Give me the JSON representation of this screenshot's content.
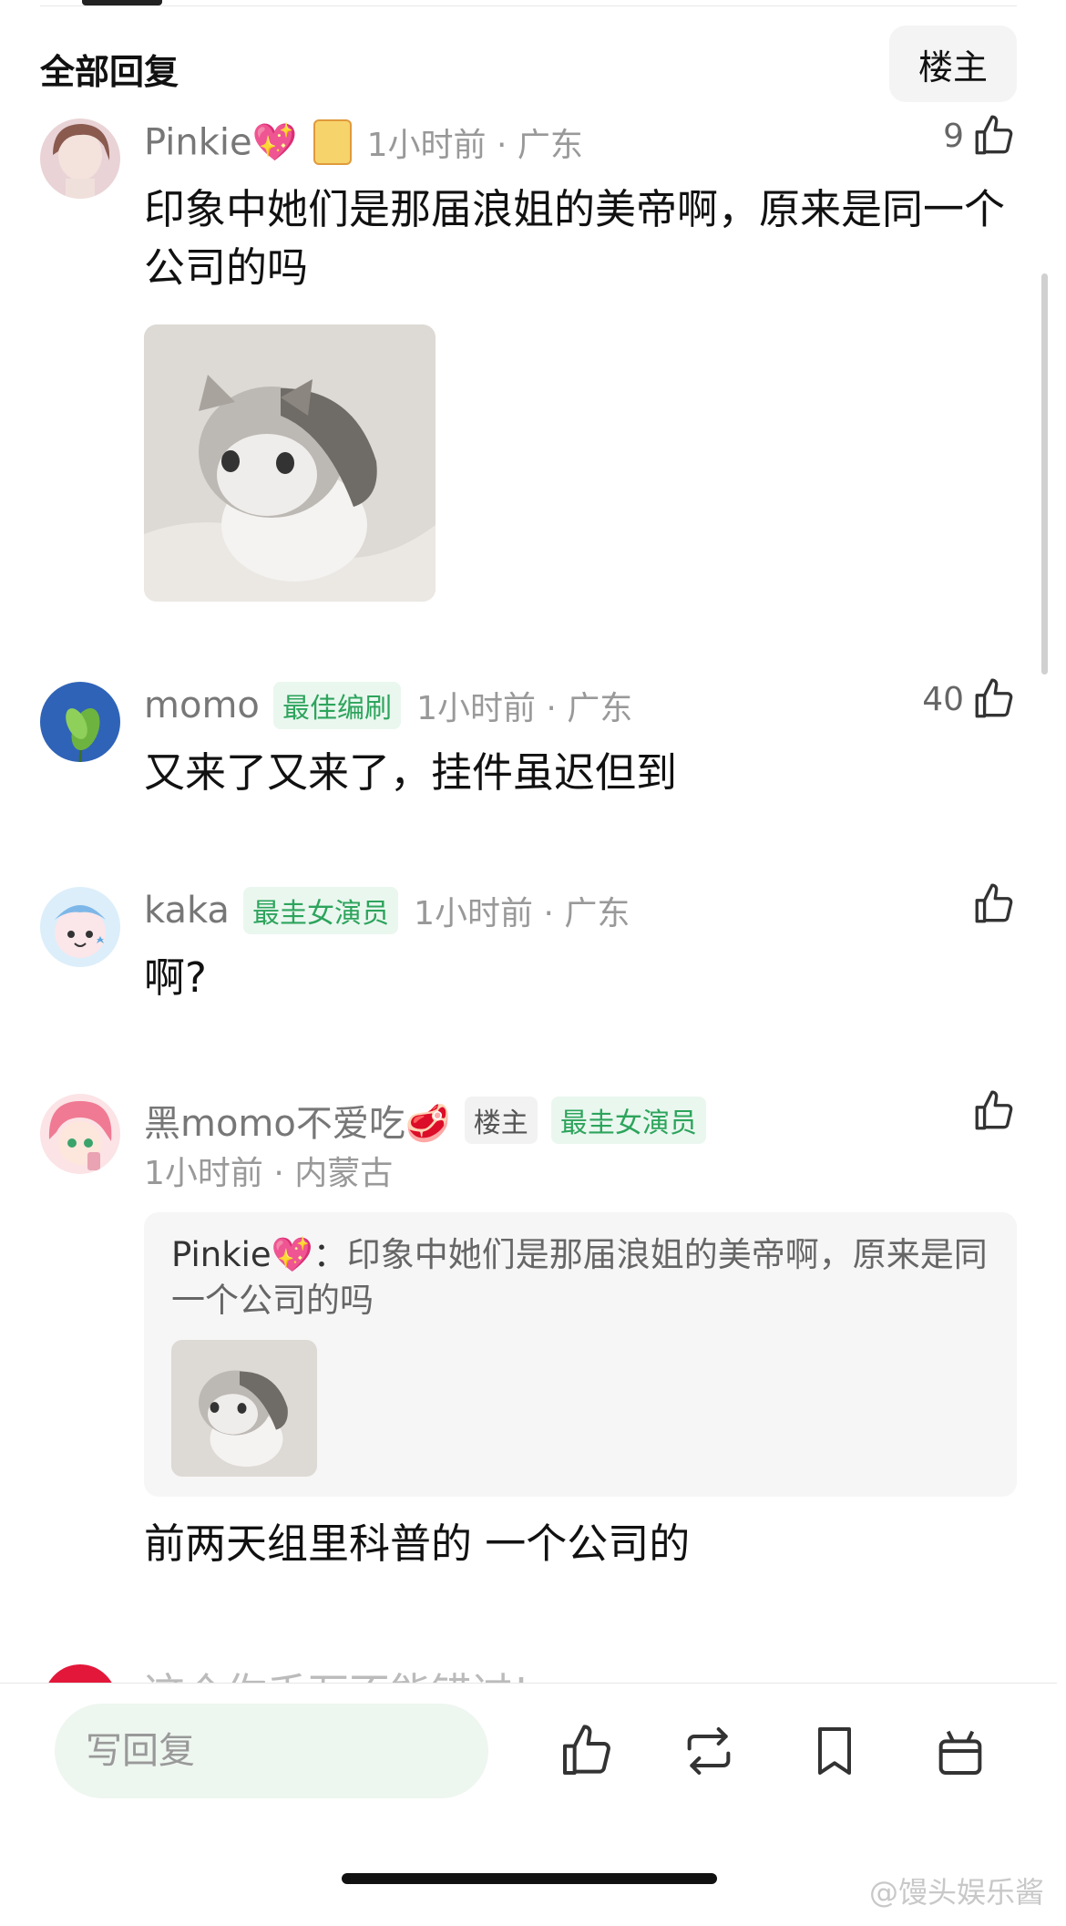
{
  "header": {
    "title": "全部回复",
    "owner_filter": "楼主"
  },
  "comments": [
    {
      "username": "Pinkie💖",
      "time": "1小时前 · 广东",
      "likes": "9",
      "text": "印象中她们是那届浪姐的美帝啊，原来是同一个公司的吗"
    },
    {
      "username": "momo",
      "badge": "最佳编刷",
      "time": "1小时前 · 广东",
      "likes": "40",
      "text": "又来了又来了，挂件虽迟但到"
    },
    {
      "username": "kaka",
      "badge": "最圭女演员",
      "time": "1小时前 · 广东",
      "likes": "",
      "text": "啊?"
    },
    {
      "username": "黑momo不爱吃🥩",
      "owner_badge": "楼主",
      "badge": "最圭女演员",
      "time": "1小时前 · 内蒙古",
      "likes": "",
      "quote_author": "Pinkie💖：",
      "quote_text": "印象中她们是那届浪姐的美帝啊，原来是同一个公司的吗",
      "text": "前两天组里科普的 一个公司的"
    }
  ],
  "peek_text": "这个你千万不能错过!",
  "bottom_bar": {
    "reply_placeholder": "写回复"
  },
  "watermark": "@馒头娱乐酱",
  "colors": {
    "badge_green": "#2da45c",
    "input_bg": "#eef6f0",
    "text": "#111111",
    "meta": "#999999"
  }
}
